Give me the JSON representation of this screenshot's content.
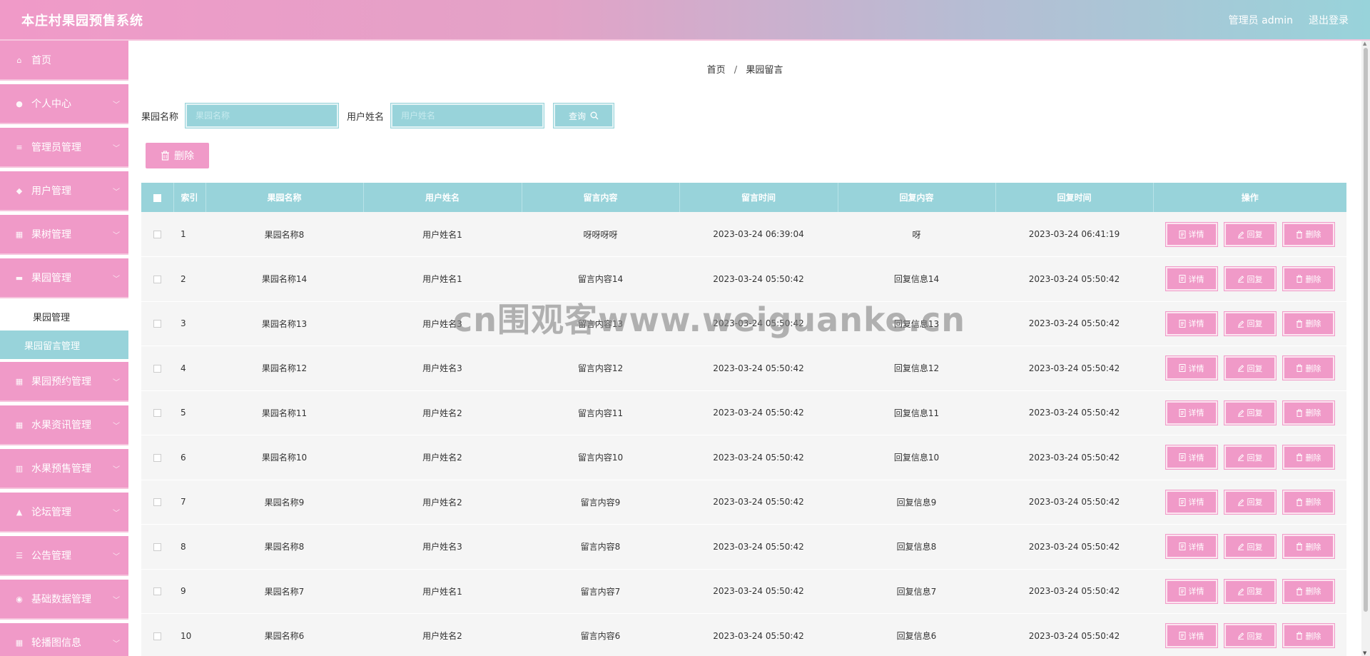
{
  "header": {
    "title": "本庄村果园预售系统",
    "admin_label": "管理员 admin",
    "logout_label": "退出登录"
  },
  "sidebar": {
    "items": [
      {
        "label": "首页",
        "icon": "home-icon",
        "glyph": "⌂"
      },
      {
        "label": "个人中心",
        "icon": "user-icon",
        "glyph": "●"
      },
      {
        "label": "管理员管理",
        "icon": "list-icon",
        "glyph": "≡"
      },
      {
        "label": "用户管理",
        "icon": "shield-icon",
        "glyph": "◆"
      },
      {
        "label": "果树管理",
        "icon": "grid-icon",
        "glyph": "▦"
      },
      {
        "label": "果园管理",
        "icon": "briefcase-icon",
        "glyph": "▬"
      }
    ],
    "sub_items": [
      {
        "label": "果园管理",
        "active": false
      },
      {
        "label": "果园留言管理",
        "active": true
      }
    ],
    "items_after": [
      {
        "label": "果园预约管理",
        "icon": "grid-icon",
        "glyph": "▦"
      },
      {
        "label": "水果资讯管理",
        "icon": "grid-icon",
        "glyph": "▦"
      },
      {
        "label": "水果预售管理",
        "icon": "chart-icon",
        "glyph": "▥"
      },
      {
        "label": "论坛管理",
        "icon": "thumb-icon",
        "glyph": "▲"
      },
      {
        "label": "公告管理",
        "icon": "sliders-icon",
        "glyph": "☰"
      },
      {
        "label": "基础数据管理",
        "icon": "database-icon",
        "glyph": "◉"
      },
      {
        "label": "轮播图信息",
        "icon": "grid-icon",
        "glyph": "▦"
      }
    ],
    "chevron_glyph": "﹀"
  },
  "breadcrumb": {
    "home": "首页",
    "separator": "/",
    "current": "果园留言"
  },
  "search": {
    "orchard_label": "果园名称",
    "orchard_placeholder": "果园名称",
    "user_label": "用户姓名",
    "user_placeholder": "用户姓名",
    "query_label": "查询"
  },
  "toolbar": {
    "delete_label": "删除"
  },
  "table": {
    "columns": [
      "索引",
      "果园名称",
      "用户姓名",
      "留言内容",
      "留言时间",
      "回复内容",
      "回复时间",
      "操作"
    ],
    "rows": [
      {
        "index": "1",
        "orchard": "果园名称8",
        "user": "用户姓名1",
        "content": "呀呀呀呀",
        "time": "2023-03-24 06:39:04",
        "reply": "呀",
        "reply_time": "2023-03-24 06:41:19"
      },
      {
        "index": "2",
        "orchard": "果园名称14",
        "user": "用户姓名1",
        "content": "留言内容14",
        "time": "2023-03-24 05:50:42",
        "reply": "回复信息14",
        "reply_time": "2023-03-24 05:50:42"
      },
      {
        "index": "3",
        "orchard": "果园名称13",
        "user": "用户姓名3",
        "content": "留言内容13",
        "time": "2023-03-24 05:50:42",
        "reply": "回复信息13",
        "reply_time": "2023-03-24 05:50:42"
      },
      {
        "index": "4",
        "orchard": "果园名称12",
        "user": "用户姓名3",
        "content": "留言内容12",
        "time": "2023-03-24 05:50:42",
        "reply": "回复信息12",
        "reply_time": "2023-03-24 05:50:42"
      },
      {
        "index": "5",
        "orchard": "果园名称11",
        "user": "用户姓名2",
        "content": "留言内容11",
        "time": "2023-03-24 05:50:42",
        "reply": "回复信息11",
        "reply_time": "2023-03-24 05:50:42"
      },
      {
        "index": "6",
        "orchard": "果园名称10",
        "user": "用户姓名2",
        "content": "留言内容10",
        "time": "2023-03-24 05:50:42",
        "reply": "回复信息10",
        "reply_time": "2023-03-24 05:50:42"
      },
      {
        "index": "7",
        "orchard": "果园名称9",
        "user": "用户姓名2",
        "content": "留言内容9",
        "time": "2023-03-24 05:50:42",
        "reply": "回复信息9",
        "reply_time": "2023-03-24 05:50:42"
      },
      {
        "index": "8",
        "orchard": "果园名称8",
        "user": "用户姓名3",
        "content": "留言内容8",
        "time": "2023-03-24 05:50:42",
        "reply": "回复信息8",
        "reply_time": "2023-03-24 05:50:42"
      },
      {
        "index": "9",
        "orchard": "果园名称7",
        "user": "用户姓名1",
        "content": "留言内容7",
        "time": "2023-03-24 05:50:42",
        "reply": "回复信息7",
        "reply_time": "2023-03-24 05:50:42"
      },
      {
        "index": "10",
        "orchard": "果园名称6",
        "user": "用户姓名2",
        "content": "留言内容6",
        "time": "2023-03-24 05:50:42",
        "reply": "回复信息6",
        "reply_time": "2023-03-24 05:50:42"
      }
    ],
    "actions": {
      "detail": "详情",
      "reply": "回复",
      "delete": "删除"
    }
  },
  "watermark": "cn围观客www.weiguanke.cn",
  "colors": {
    "pink": "#f09ac8",
    "teal": "#98d3da",
    "row_bg": "#f5f5f5"
  }
}
